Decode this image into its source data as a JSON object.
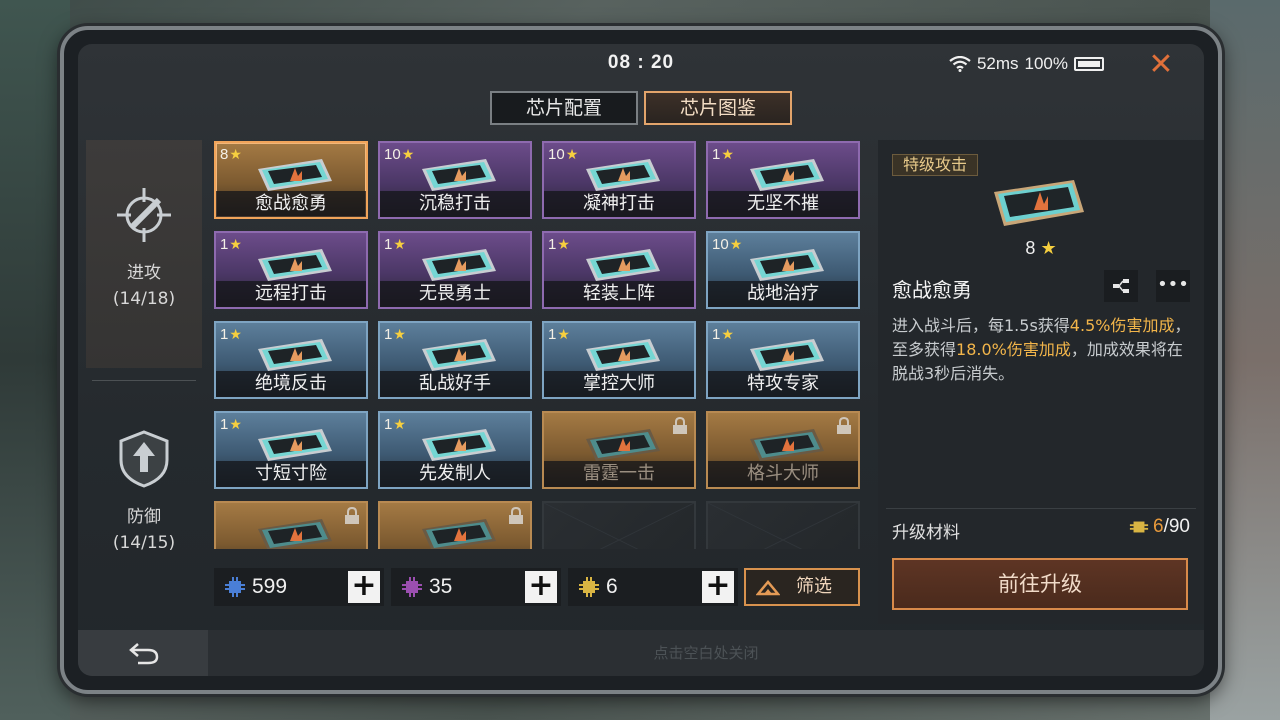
{
  "status": {
    "time": "08 : 20",
    "ping": "52ms",
    "battery": "100%"
  },
  "tabs": [
    {
      "label": "芯片配置",
      "active": false
    },
    {
      "label": "芯片图鉴",
      "active": true
    }
  ],
  "categories": [
    {
      "label": "进攻",
      "count": "(14/18)",
      "icon": "crosshair-icon"
    },
    {
      "label": "防御",
      "count": "(14/15)",
      "icon": "shield-icon"
    }
  ],
  "chips": [
    {
      "stars": "8",
      "name": "愈战愈勇",
      "rarity": "gold",
      "selected": true,
      "locked": false
    },
    {
      "stars": "10",
      "name": "沉稳打击",
      "rarity": "purple",
      "locked": false
    },
    {
      "stars": "10",
      "name": "凝神打击",
      "rarity": "purple",
      "locked": false
    },
    {
      "stars": "1",
      "name": "无坚不摧",
      "rarity": "purple",
      "locked": false
    },
    {
      "stars": "1",
      "name": "远程打击",
      "rarity": "purple",
      "locked": false
    },
    {
      "stars": "1",
      "name": "无畏勇士",
      "rarity": "purple",
      "locked": false
    },
    {
      "stars": "1",
      "name": "轻装上阵",
      "rarity": "purple",
      "locked": false
    },
    {
      "stars": "10",
      "name": "战地治疗",
      "rarity": "blue",
      "locked": false
    },
    {
      "stars": "1",
      "name": "绝境反击",
      "rarity": "blue",
      "locked": false
    },
    {
      "stars": "1",
      "name": "乱战好手",
      "rarity": "blue",
      "locked": false
    },
    {
      "stars": "1",
      "name": "掌控大师",
      "rarity": "blue",
      "locked": false
    },
    {
      "stars": "1",
      "name": "特攻专家",
      "rarity": "blue",
      "locked": false
    },
    {
      "stars": "1",
      "name": "寸短寸险",
      "rarity": "blue",
      "locked": false
    },
    {
      "stars": "1",
      "name": "先发制人",
      "rarity": "blue",
      "locked": false
    },
    {
      "stars": "",
      "name": "雷霆一击",
      "rarity": "gold",
      "locked": true
    },
    {
      "stars": "",
      "name": "格斗大师",
      "rarity": "gold",
      "locked": true
    },
    {
      "stars": "",
      "name": "",
      "rarity": "gold",
      "locked": true
    },
    {
      "stars": "",
      "name": "",
      "rarity": "gold",
      "locked": true
    },
    {
      "stars": "",
      "name": "",
      "rarity": "empty",
      "locked": false
    },
    {
      "stars": "",
      "name": "",
      "rarity": "empty",
      "locked": false
    }
  ],
  "currencies": [
    {
      "value": "599",
      "color": "#4a7fd6",
      "icon": "blue-chip-icon"
    },
    {
      "value": "35",
      "color": "#9b4fb0",
      "icon": "purple-chip-icon"
    },
    {
      "value": "6",
      "color": "#d9b543",
      "icon": "gold-chip-icon"
    }
  ],
  "filter": {
    "label": "筛选"
  },
  "detail": {
    "rank": "特级攻击",
    "stars": "8",
    "name": "愈战愈勇",
    "desc_1": "进入战斗后，每1.5s获得",
    "desc_hl1": "4.5%伤害加成",
    "desc_2": "，至多获得",
    "desc_hl2": "18.0%伤害加成",
    "desc_3": "，加成效果将在脱战3秒后消失。",
    "material_label": "升级材料",
    "material_have": "6",
    "material_need": "/90",
    "upgrade_label": "前往升级"
  },
  "footer": {
    "hint": "点击空白处关闭"
  },
  "colors": {
    "accent": "#e0703a",
    "gold_text": "#f2b54a"
  }
}
